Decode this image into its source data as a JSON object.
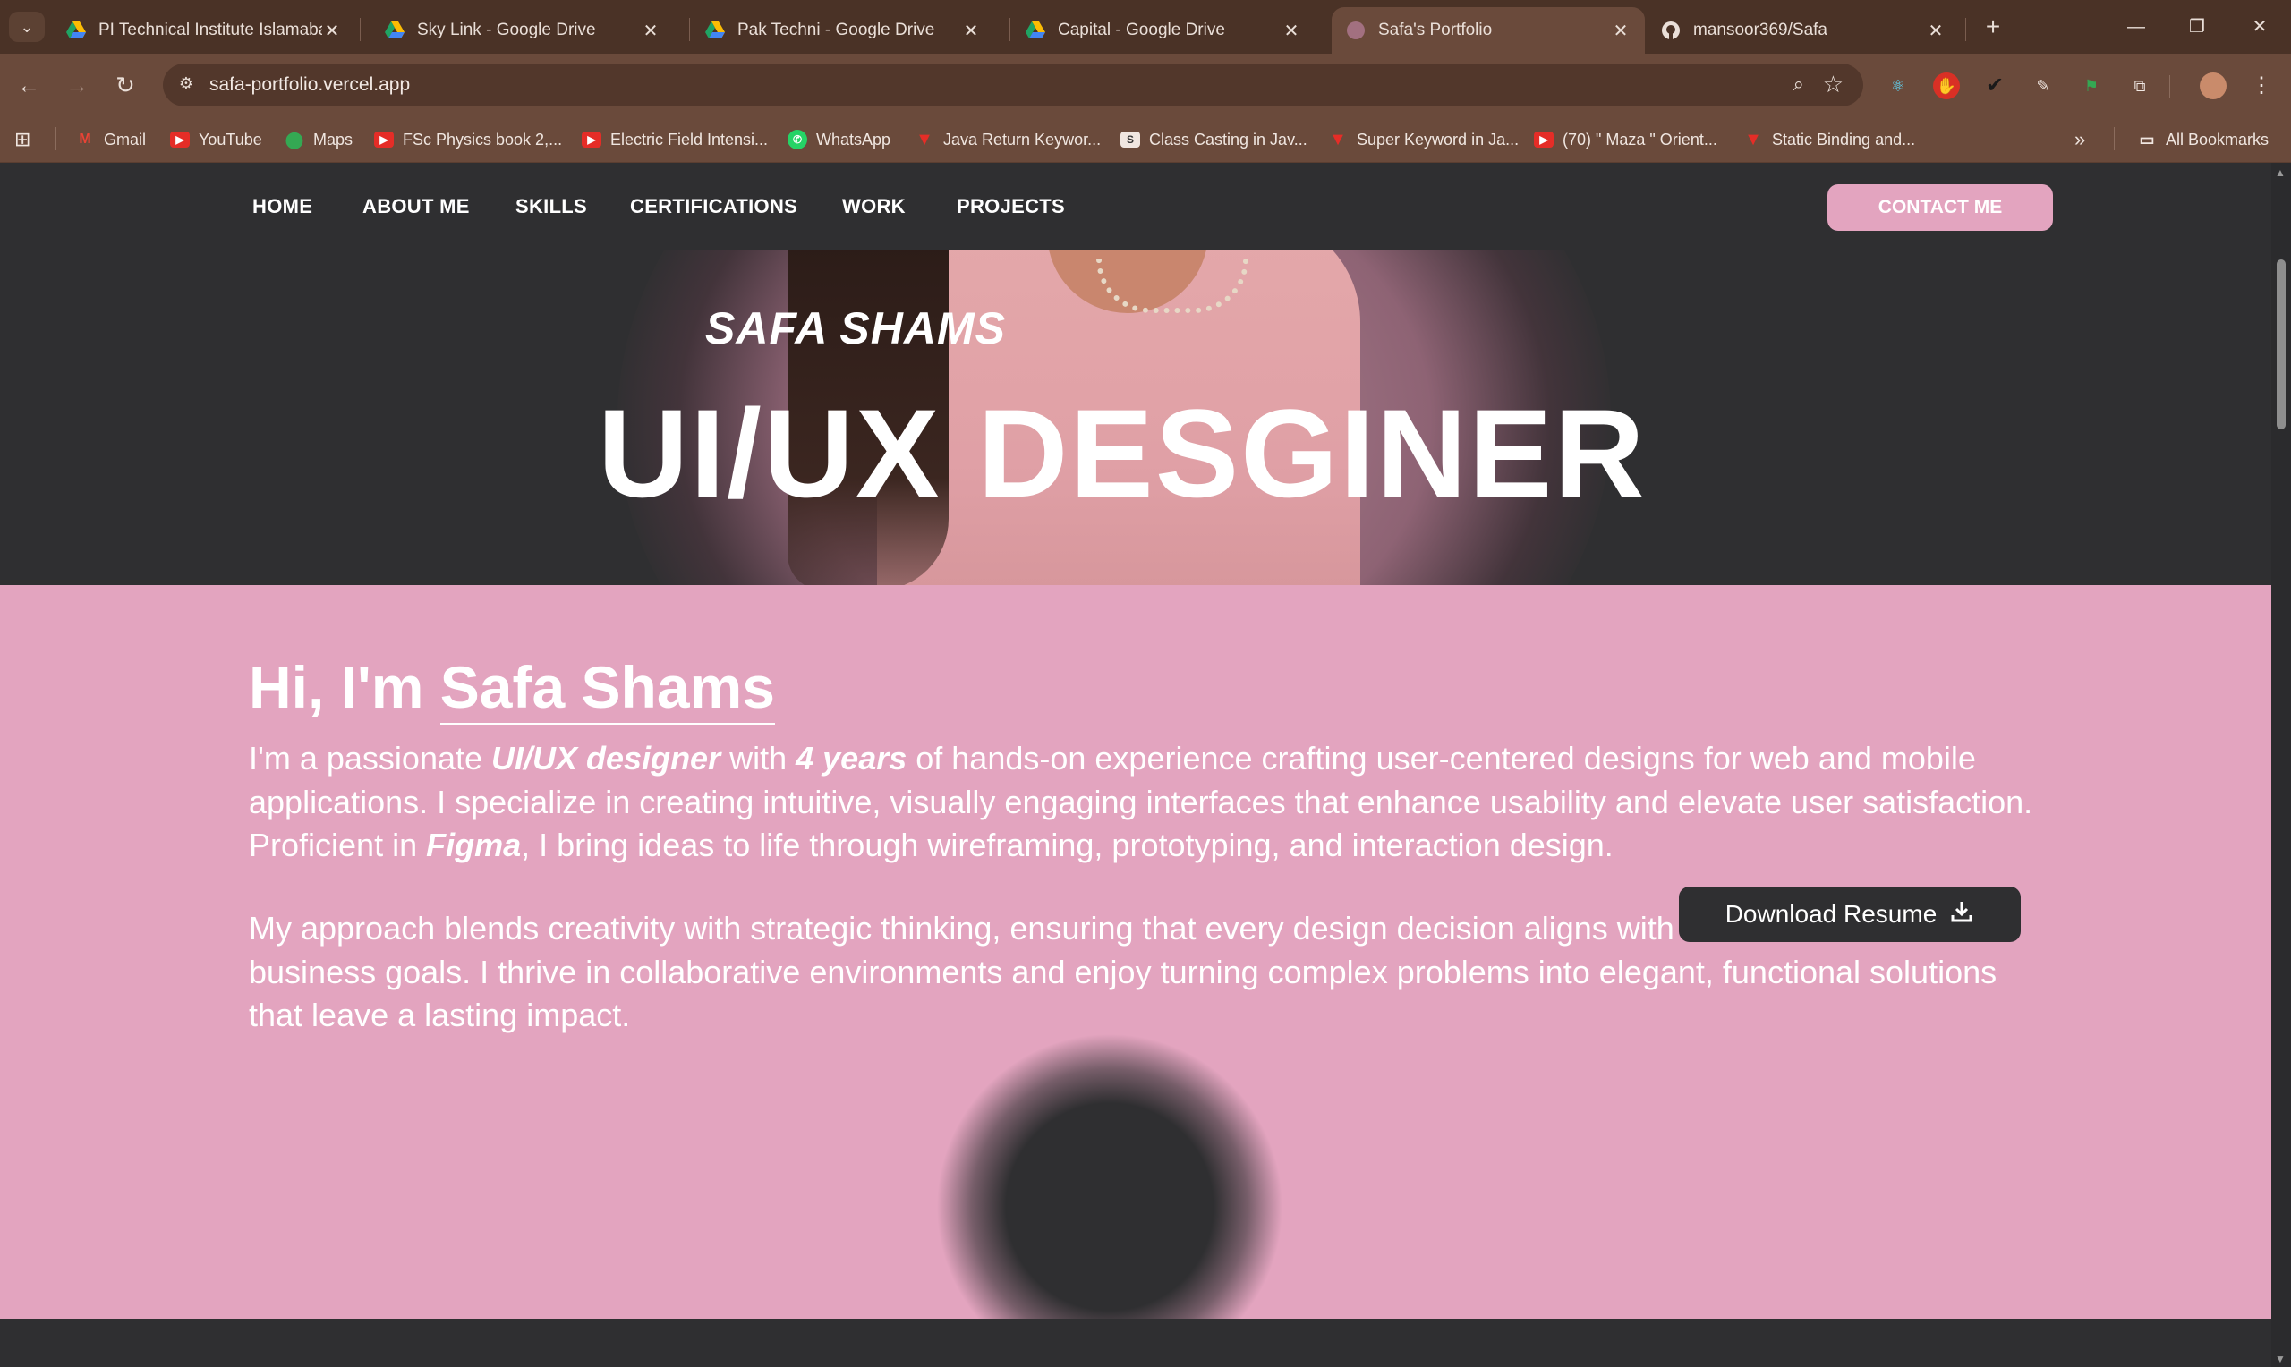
{
  "browser": {
    "tabs": [
      {
        "title": "PI Technical Institute Islamabad",
        "icon": "google-drive-icon",
        "active": false
      },
      {
        "title": "Sky Link - Google Drive",
        "icon": "google-drive-icon",
        "active": false
      },
      {
        "title": "Pak Techni - Google Drive",
        "icon": "google-drive-icon",
        "active": false
      },
      {
        "title": "Capital - Google Drive",
        "icon": "google-drive-icon",
        "active": false
      },
      {
        "title": "Safa's Portfolio",
        "icon": "portfolio-favicon-icon",
        "active": true
      },
      {
        "title": "mansoor369/Safa",
        "icon": "github-icon",
        "active": false
      }
    ],
    "url": "safa-portfolio.vercel.app",
    "bookmarks": [
      {
        "label": "Gmail",
        "icon": "gmail-icon"
      },
      {
        "label": "YouTube",
        "icon": "youtube-icon"
      },
      {
        "label": "Maps",
        "icon": "maps-icon"
      },
      {
        "label": "FSc Physics book 2,...",
        "icon": "youtube-icon"
      },
      {
        "label": "Electric Field Intensi...",
        "icon": "youtube-icon"
      },
      {
        "label": "WhatsApp",
        "icon": "whatsapp-icon"
      },
      {
        "label": "Java Return Keywor...",
        "icon": "red-v-icon"
      },
      {
        "label": "Class Casting in Jav...",
        "icon": "s-icon"
      },
      {
        "label": "Super Keyword in Ja...",
        "icon": "red-v-icon"
      },
      {
        "label": "(70) \" Maza \" Orient...",
        "icon": "youtube-icon"
      },
      {
        "label": "Static Binding and...",
        "icon": "red-v-icon"
      }
    ],
    "all_bookmarks": "All Bookmarks",
    "more_bookmarks": "»"
  },
  "site": {
    "nav": [
      "HOME",
      "ABOUT ME",
      "SKILLS",
      "CERTIFICATIONS",
      "WORK",
      "PROJECTS"
    ],
    "contact_button": "CONTACT ME",
    "hero_name": "SAFA SHAMS",
    "hero_title": "UI/UX DESGINER",
    "greeting_prefix": "Hi, I'm ",
    "greeting_name": "Safa Shams",
    "para1": {
      "t1": "I'm a passionate ",
      "b1": "UI/UX designer",
      "t2": " with ",
      "b2": "4 years",
      "t3": " of hands-on experience crafting user-centered designs for web and mobile applications. I specialize in creating intuitive, visually engaging interfaces that enhance usability and elevate user satisfaction. Proficient in ",
      "b3": "Figma",
      "t4": ", I bring ideas to life through wireframing, prototyping, and interaction design."
    },
    "para2": "My approach blends creativity with strategic thinking, ensuring that every design decision aligns with both user needs and business goals. I thrive in collaborative environments and enjoy turning complex problems into elegant, functional solutions that leave a lasting impact.",
    "download_button": "Download Resume"
  },
  "colors": {
    "accent_pink": "#e3a4bf",
    "dark_bg": "#2f2f31",
    "browser_frame": "#6a4a3b"
  }
}
